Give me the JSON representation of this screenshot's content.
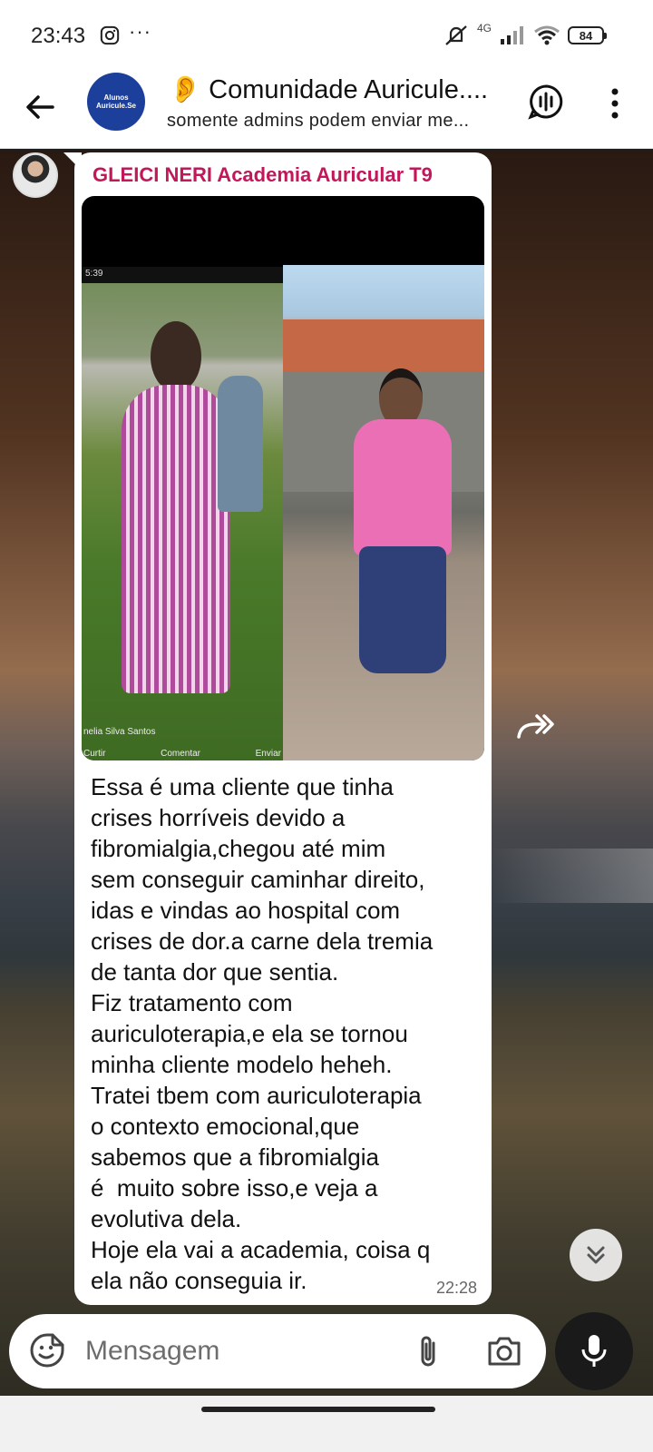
{
  "status_bar": {
    "time": "23:43",
    "more": "···",
    "network": "4G",
    "battery": "84"
  },
  "header": {
    "group_avatar_text_1": "Alunos",
    "group_avatar_text_2": "Auricule.Se",
    "title": "👂 Comunidade Auricule....",
    "subtitle": "somente admins podem enviar me..."
  },
  "message": {
    "sender": "GLEICI NERI Academia Auricular T9",
    "photo": {
      "left_status": "5:39",
      "left_caption": "nelia Silva Santos",
      "left_actions": [
        "Curtir",
        "Comentar",
        "Enviar"
      ]
    },
    "text": "Essa é uma cliente que tinha\ncrises horríveis devido a\nfibromialgia,chegou até mim\nsem conseguir caminhar direito,\nidas e vindas ao hospital com\ncrises de dor.a carne dela tremia\nde tanta dor que sentia.\nFiz tratamento com\nauriculoterapia,e ela se tornou\nminha cliente modelo heheh.\nTratei tbem com auriculoterapia\no contexto emocional,que\nsabemos que a fibromialgia\né  muito sobre isso,e veja a\nevolutiva dela.\nHoje ela vai a academia, coisa q\nela não conseguia ir.",
    "time": "22:28"
  },
  "composer": {
    "placeholder": "Mensagem"
  },
  "icons": [
    "back-arrow-icon",
    "voice-chat-icon",
    "more-vert-icon",
    "forward-icon",
    "scroll-down-icon",
    "sticker-icon",
    "attach-icon",
    "camera-icon",
    "mic-icon"
  ]
}
